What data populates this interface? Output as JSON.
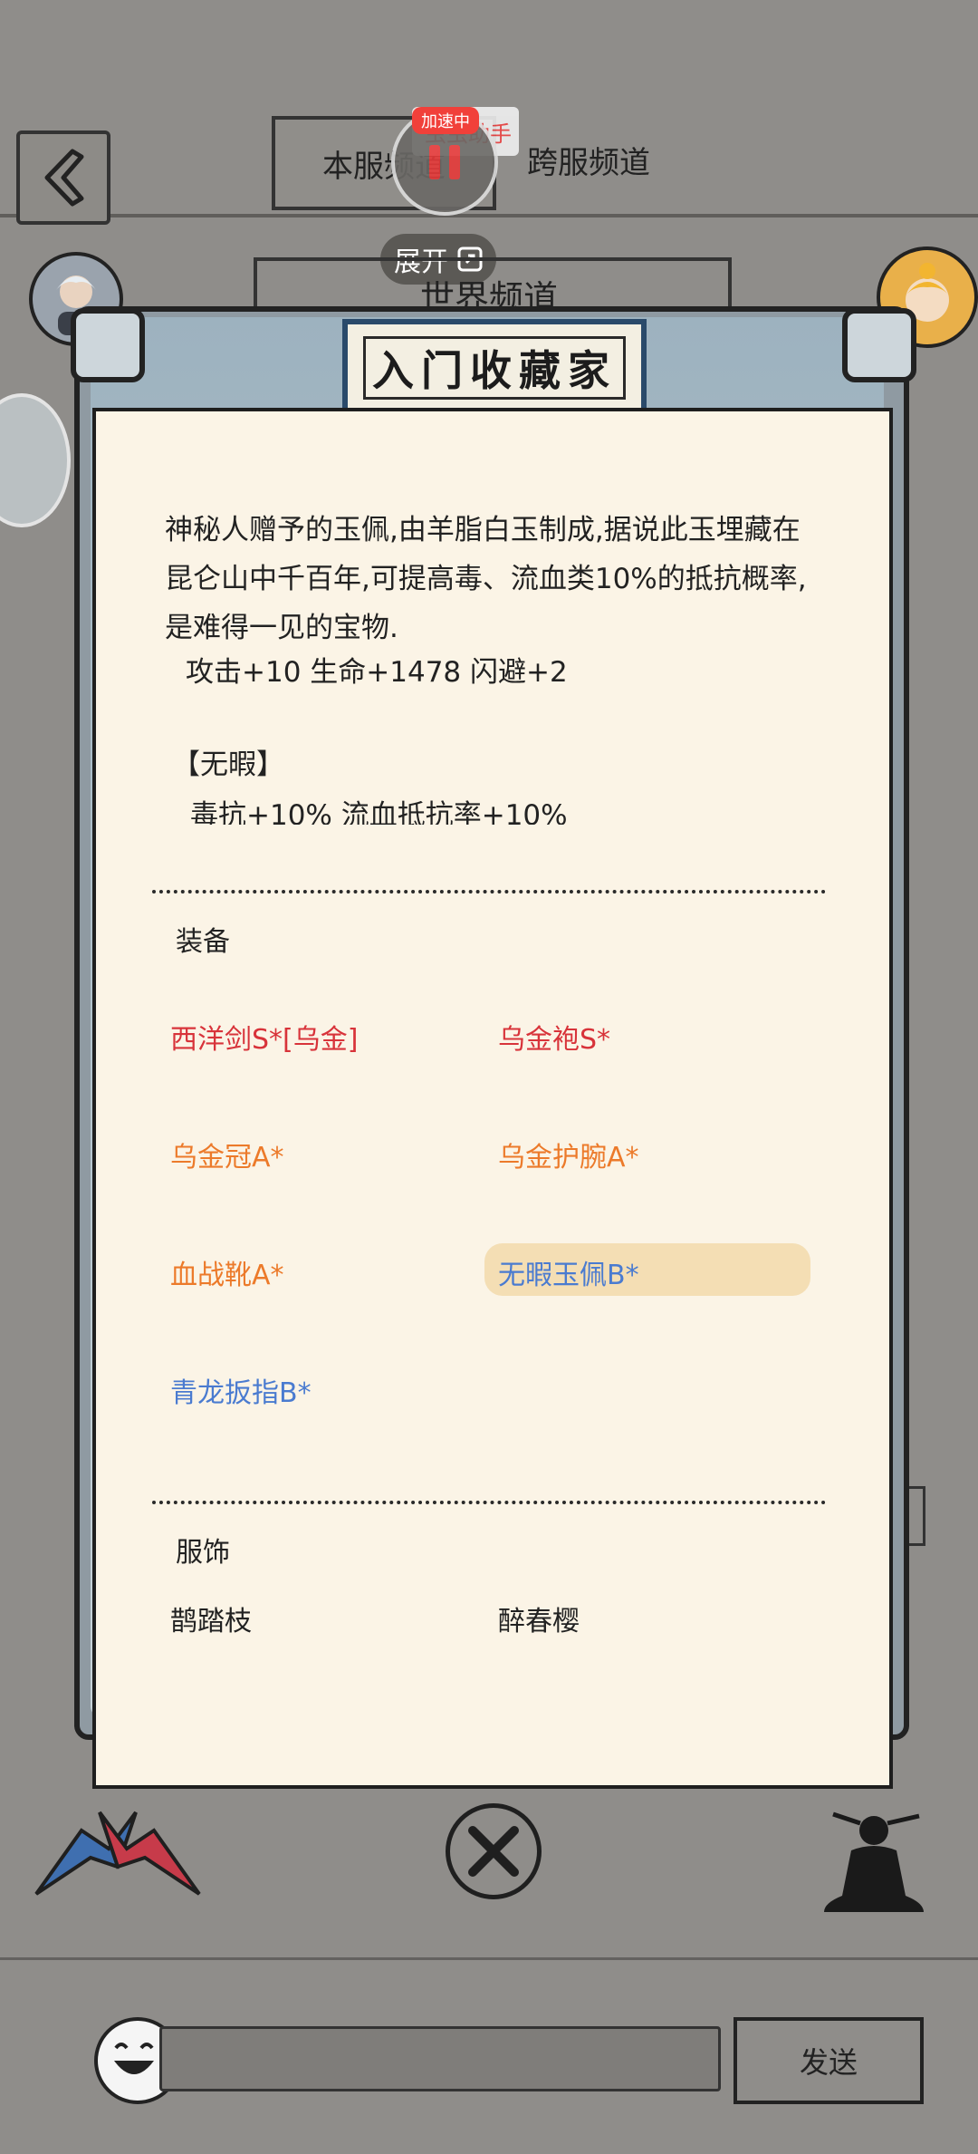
{
  "header": {
    "channel_server": "本服频道",
    "channel_cross": "跨服频道",
    "world_channel": "世界频道",
    "recorder_badge": "加速中",
    "recorder_label": "虫虫助手",
    "expand_label": "展开"
  },
  "modal": {
    "title": "入门收藏家",
    "description": "神秘人赠予的玉佩,由羊脂白玉制成,据说此玉埋藏在昆仑山中千百年,可提高毒、流血类10%的抵抗概率,是难得一见的宝物.",
    "stats": "攻击+10 生命+1478 闪避+2",
    "trait_title": "【无暇】",
    "trait_effect": "毒抗+10% 流血抵抗率+10%",
    "equipment_label": "装备",
    "equipment": [
      {
        "name": "西洋剑S*[乌金]",
        "color": "#d8333a"
      },
      {
        "name": "乌金袍S*",
        "color": "#d8333a"
      },
      {
        "name": "乌金冠A*",
        "color": "#ec7a2a"
      },
      {
        "name": "乌金护腕A*",
        "color": "#ec7a2a"
      },
      {
        "name": "血战靴A*",
        "color": "#ec7a2a"
      },
      {
        "name": "无暇玉佩B*",
        "color": "#4a7bd0"
      },
      {
        "name": "青龙扳指B*",
        "color": "#4a7bd0"
      }
    ],
    "costume_label": "服饰",
    "costumes": [
      "鹊踏枝",
      "醉春樱"
    ]
  },
  "footer": {
    "send_label": "发送"
  },
  "icons": [
    "back-arrow-icon",
    "expand-icon",
    "avatar",
    "combat-icon",
    "cancel-sword-icon",
    "meditate-icon",
    "emoji-icon"
  ]
}
